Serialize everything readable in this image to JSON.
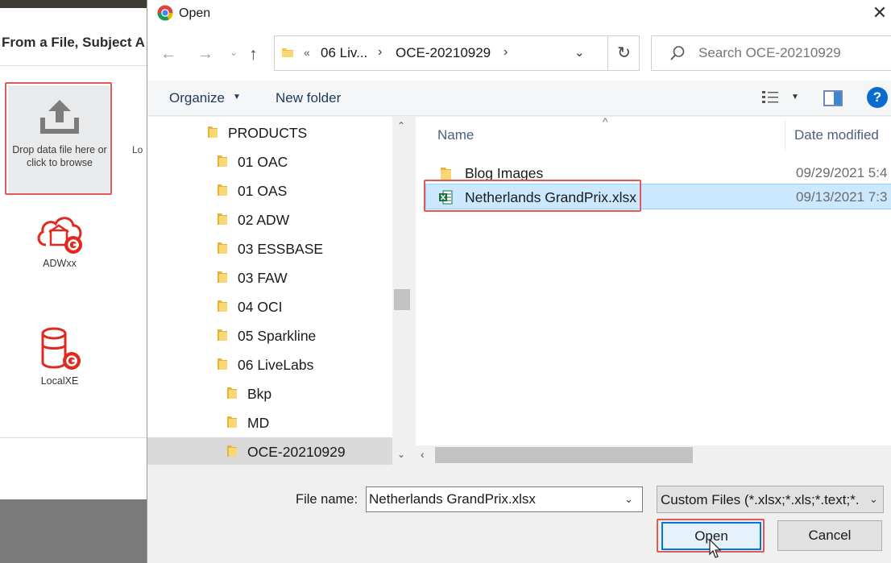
{
  "background_app": {
    "section_title": "From a File, Subject A",
    "drop_zone_text": "Drop data file here or click to browse",
    "side_label": "Lo",
    "connections": [
      {
        "label": "ADWxx"
      },
      {
        "label": "LocalXE"
      }
    ]
  },
  "dialog": {
    "title": "Open",
    "close_label": "✕"
  },
  "address": {
    "overflow": "«",
    "segments": [
      "06 Liv...",
      "OCE-20210929"
    ],
    "separator": "›",
    "dropdown_glyph": "⌄",
    "refresh_glyph": "↻"
  },
  "search": {
    "placeholder": "Search OCE-20210929"
  },
  "toolbar": {
    "organize_label": "Organize",
    "new_folder_label": "New folder",
    "help_label": "?"
  },
  "nav_tree": {
    "items": [
      {
        "label": "PRODUCTS"
      },
      {
        "label": "01 OAC"
      },
      {
        "label": "01 OAS"
      },
      {
        "label": "02 ADW"
      },
      {
        "label": "03 ESSBASE"
      },
      {
        "label": "03 FAW"
      },
      {
        "label": "04 OCI"
      },
      {
        "label": "05 Sparkline"
      },
      {
        "label": "06 LiveLabs"
      },
      {
        "label": "Bkp"
      },
      {
        "label": "MD"
      },
      {
        "label": "OCE-20210929"
      }
    ]
  },
  "file_list": {
    "columns": {
      "name": "Name",
      "date": "Date modified"
    },
    "rows": [
      {
        "name": "Blog Images",
        "date": "09/29/2021 5:4",
        "type": "folder"
      },
      {
        "name": "Netherlands GrandPrix.xlsx",
        "date": "09/13/2021 7:3",
        "type": "excel"
      }
    ]
  },
  "footer": {
    "file_name_label": "File name:",
    "file_name_value": "Netherlands GrandPrix.xlsx",
    "file_type_value": "Custom Files (*.xlsx;*.xls;*.text;*.",
    "open_label": "Open",
    "cancel_label": "Cancel"
  },
  "colors": {
    "highlight": "#e05a5a",
    "selection": "#cce8ff",
    "folder": "#f5c542",
    "accent": "#0078d7"
  }
}
